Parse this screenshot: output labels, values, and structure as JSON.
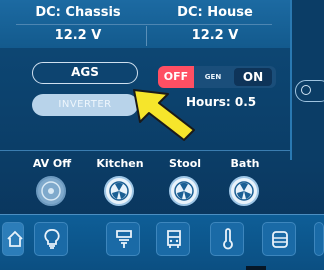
{
  "dc_monitor": {
    "chassis": {
      "label": "DC: Chassis",
      "voltage": "12.2 V"
    },
    "house": {
      "label": "DC: House",
      "voltage": "12.2 V"
    }
  },
  "controls": {
    "ags_label": "AGS",
    "inverter_label": "INVERTER",
    "generator": {
      "off_label": "OFF",
      "gen_label": "GEN",
      "on_label": "ON",
      "state": "OFF"
    },
    "hours_text": "Hours: 0.5"
  },
  "fan_zones": [
    {
      "label": "AV Off",
      "icon": "fan-icon"
    },
    {
      "label": "Kitchen",
      "icon": "fan-icon"
    },
    {
      "label": "Stool",
      "icon": "fan-icon"
    },
    {
      "label": "Bath",
      "icon": "fan-icon"
    }
  ],
  "tab_bar": {
    "items": [
      "home-icon",
      "lightbulb-icon",
      "awning-icon",
      "vehicle-icon",
      "thermometer-icon",
      "tank-icon"
    ]
  },
  "colors": {
    "off_active": "#ff4f63",
    "panel_blue": "#0e4a78",
    "arrow_yellow": "#f6e52b"
  }
}
